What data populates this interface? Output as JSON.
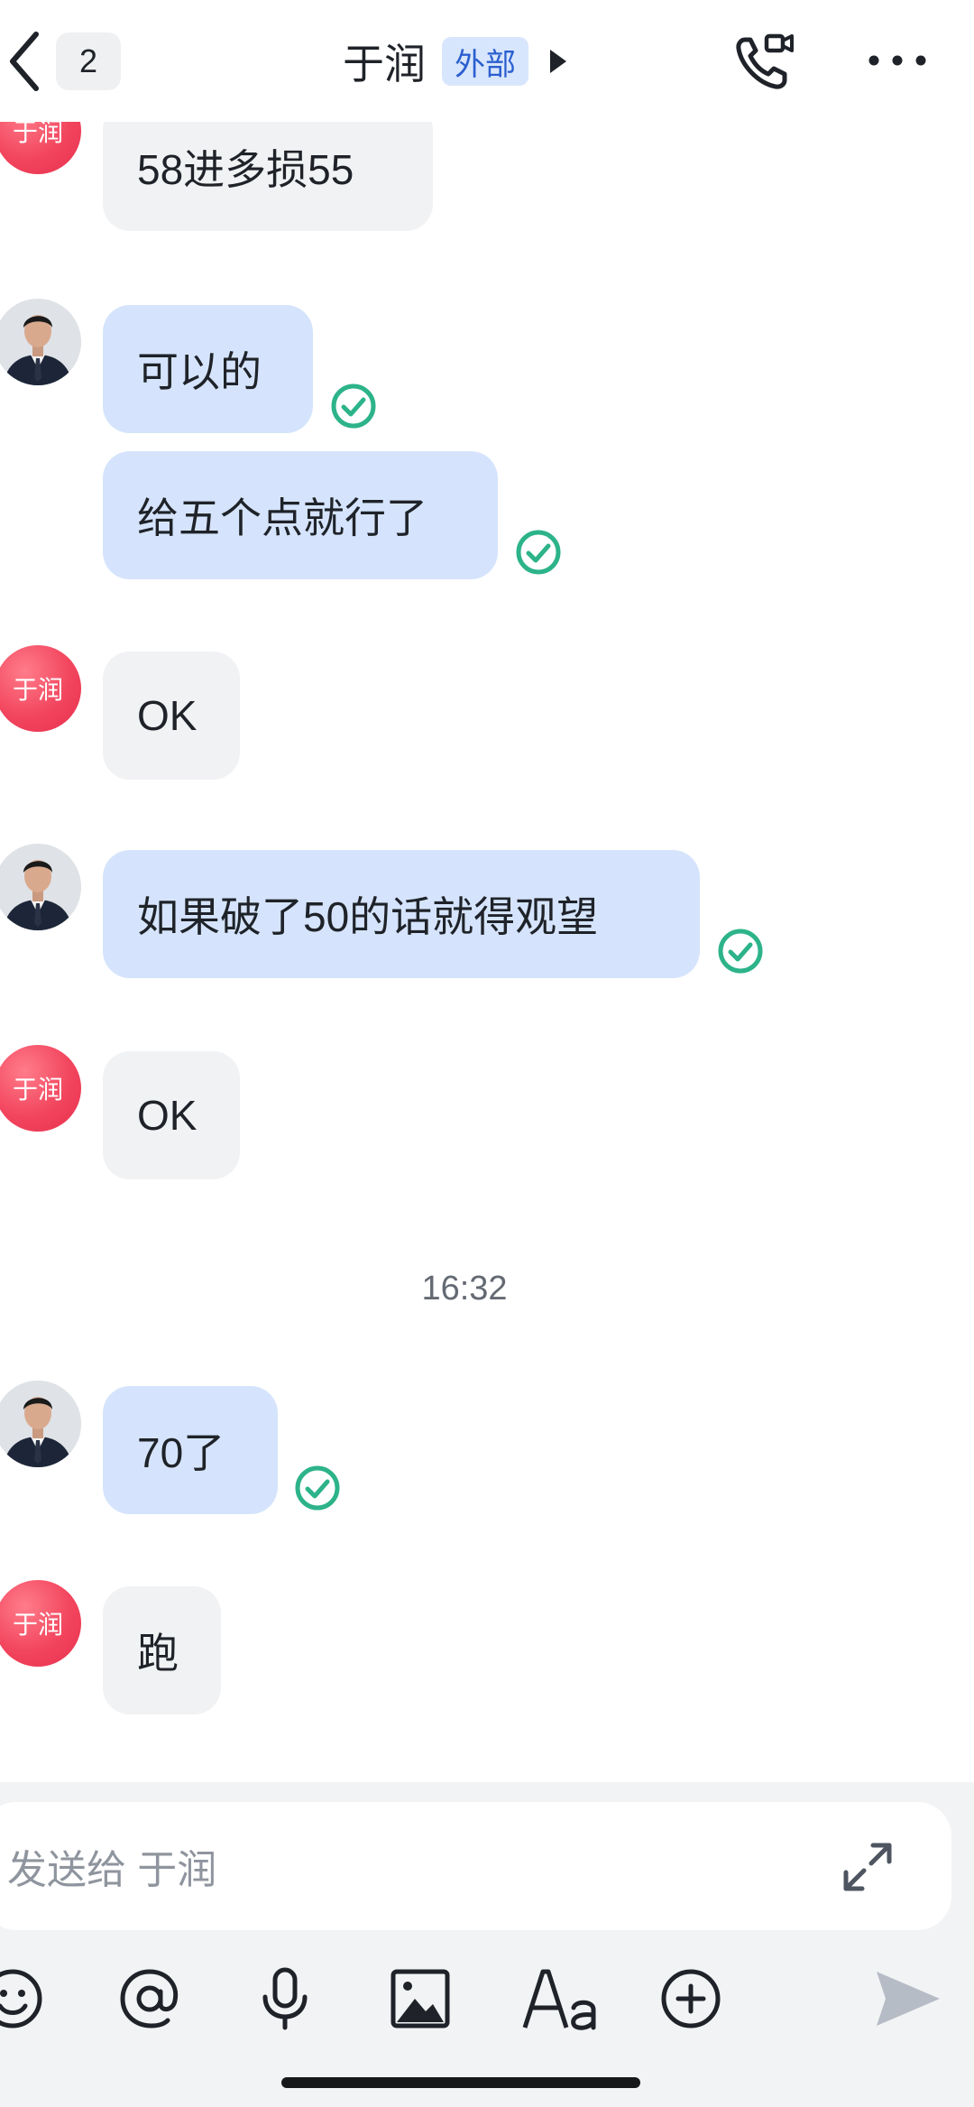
{
  "header": {
    "unread_count": "2",
    "title": "于润",
    "tag": "外部"
  },
  "contact": {
    "avatar_text": "于润"
  },
  "messages": [
    {
      "sender": "contact",
      "text": "58进多损55"
    },
    {
      "sender": "me",
      "text": "可以的",
      "status": "read"
    },
    {
      "sender": "me",
      "text": "给五个点就行了",
      "status": "read"
    },
    {
      "sender": "contact",
      "text": "OK"
    },
    {
      "sender": "me",
      "text": "如果破了50的话就得观望",
      "status": "read"
    },
    {
      "sender": "contact",
      "text": "OK"
    },
    {
      "type": "time",
      "text": "16:32"
    },
    {
      "sender": "me",
      "text": "70了",
      "status": "read"
    },
    {
      "sender": "contact",
      "text": "跑"
    }
  ],
  "composer": {
    "placeholder": "发送给 于润",
    "tools": [
      "emoji-icon",
      "mention-icon",
      "voice-icon",
      "image-icon",
      "text-format-icon",
      "add-icon",
      "send-icon"
    ]
  },
  "colors": {
    "outgoing_bubble": "#d5e4fc",
    "incoming_bubble": "#f1f2f4",
    "read_check": "#2db38a",
    "avatar_red": "#f2455e",
    "tag_bg": "#d8e6fd",
    "tag_text": "#2b5fcf"
  }
}
